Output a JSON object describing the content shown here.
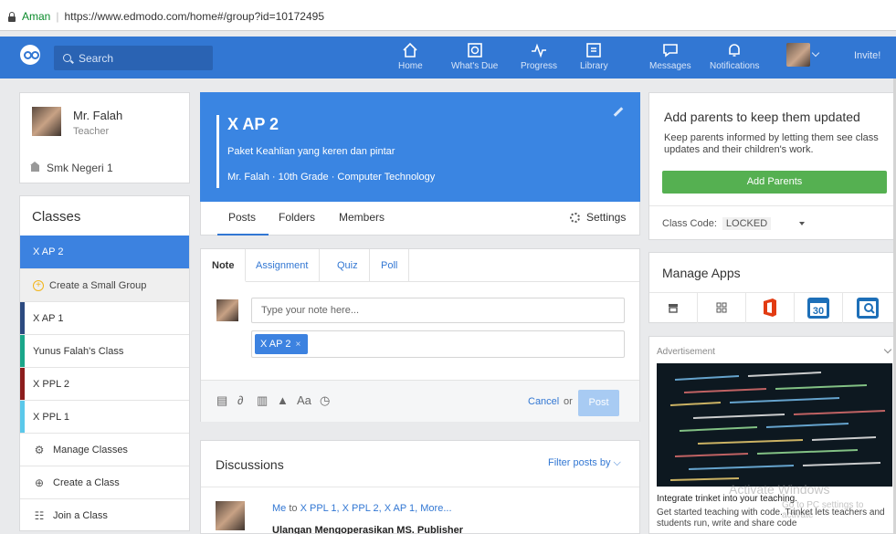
{
  "browser": {
    "secure_label": "Aman",
    "url": "https://www.edmodo.com/home#/group?id=10172495"
  },
  "nav": {
    "search_placeholder": "Search",
    "items": [
      {
        "label": "Home",
        "icon": "home-icon"
      },
      {
        "label": "What's Due",
        "icon": "calendar-icon"
      },
      {
        "label": "Progress",
        "icon": "progress-icon"
      },
      {
        "label": "Library",
        "icon": "library-icon"
      },
      {
        "label": "Messages",
        "icon": "messages-icon"
      },
      {
        "label": "Notifications",
        "icon": "bell-icon"
      }
    ],
    "invite": "Invite!"
  },
  "profile": {
    "name": "Mr. Falah",
    "role": "Teacher",
    "school": "Smk Negeri 1"
  },
  "classes": {
    "header": "Classes",
    "active": "X AP 2",
    "create_small_group": "Create a Small Group",
    "list": [
      {
        "name": "X AP 1",
        "color": "#2c4a80"
      },
      {
        "name": "Yunus Falah's Class",
        "color": "#1aa68a"
      },
      {
        "name": "X PPL 2",
        "color": "#8c1d1d"
      },
      {
        "name": "X PPL 1",
        "color": "#5bc8ea"
      }
    ],
    "manage": "Manage Classes",
    "create": "Create a Class",
    "join": "Join a Class"
  },
  "group": {
    "title": "X AP 2",
    "description": "Paket Keahlian yang keren dan pintar",
    "meta": "Mr. Falah · 10th Grade · Computer Technology",
    "tabs": [
      "Posts",
      "Folders",
      "Members"
    ],
    "settings": "Settings"
  },
  "composer": {
    "tabs": [
      "Note",
      "Assignment",
      "Quiz",
      "Poll"
    ],
    "placeholder": "Type your note here...",
    "recipient": "X AP 2",
    "recipient_remove": "×",
    "cancel": "Cancel",
    "or": "or",
    "post": "Post",
    "tool_icons": [
      "document-icon",
      "link-icon",
      "library-icon",
      "drive-icon",
      "font-icon",
      "clock-icon"
    ],
    "font_tool_label": "Aa"
  },
  "discussions": {
    "title": "Discussions",
    "filter": "Filter posts by",
    "post": {
      "me": "Me",
      "to_word": "to",
      "recipients": "X PPL 1, X PPL 2, X AP 1, More...",
      "subject": "Ulangan Mengoperasikan MS. Publisher"
    }
  },
  "parents": {
    "title": "Add parents to keep them updated",
    "text": "Keep parents informed by letting them see class updates and their children's work.",
    "button": "Add Parents",
    "code_label": "Class Code:",
    "code_value": "LOCKED"
  },
  "apps": {
    "title": "Manage Apps",
    "icons": [
      "store-icon",
      "grid-icon",
      "office-icon",
      "calendar-30-icon",
      "quiz-search-icon"
    ],
    "calendar_number": "30"
  },
  "ad": {
    "label": "Advertisement",
    "headline": "Integrate trinket into your teaching.",
    "body": "Get started teaching with code. Trinket lets teachers and students run, write and share code"
  },
  "watermark": {
    "line1": "Activate Windows",
    "line2": "Go to PC settings to activate"
  }
}
